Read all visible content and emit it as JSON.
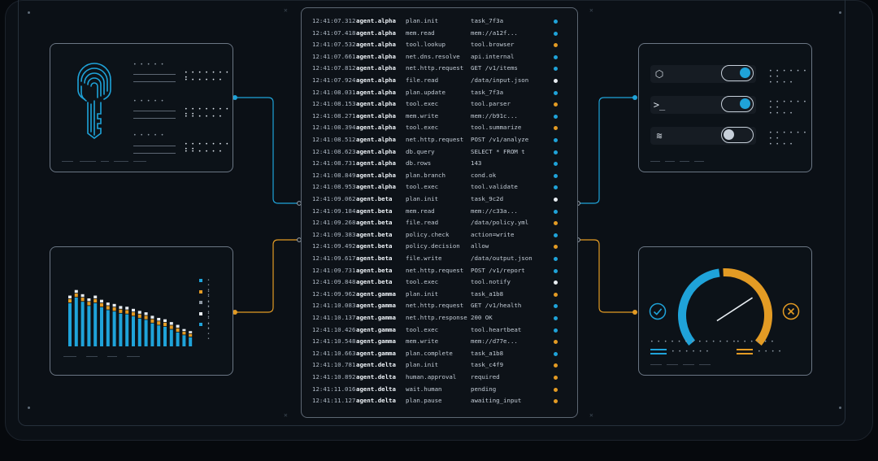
{
  "colors": {
    "blue": "#1fa3d9",
    "orange": "#e39b24",
    "white": "#e8edf2",
    "gray": "#8f99a4"
  },
  "log": [
    {
      "time": "12:41:07.312",
      "agent": "agent.alpha",
      "action": "plan.init",
      "target": "task_7f3a",
      "status": "blue"
    },
    {
      "time": "12:41:07.418",
      "agent": "agent.alpha",
      "action": "mem.read",
      "target": "mem://a12f...",
      "status": "blue"
    },
    {
      "time": "12:41:07.532",
      "agent": "agent.alpha",
      "action": "tool.lookup",
      "target": "tool.browser",
      "status": "orange"
    },
    {
      "time": "12:41:07.661",
      "agent": "agent.alpha",
      "action": "net.dns.resolve",
      "target": "api.internal",
      "status": "blue"
    },
    {
      "time": "12:41:07.812",
      "agent": "agent.alpha",
      "action": "net.http.request",
      "target": "GET /v1/items",
      "status": "blue"
    },
    {
      "time": "12:41:07.924",
      "agent": "agent.alpha",
      "action": "file.read",
      "target": "/data/input.json",
      "status": "white"
    },
    {
      "time": "12:41:08.031",
      "agent": "agent.alpha",
      "action": "plan.update",
      "target": "task_7f3a",
      "status": "blue"
    },
    {
      "time": "12:41:08.153",
      "agent": "agent.alpha",
      "action": "tool.exec",
      "target": "tool.parser",
      "status": "orange"
    },
    {
      "time": "12:41:08.271",
      "agent": "agent.alpha",
      "action": "mem.write",
      "target": "mem://b91c...",
      "status": "blue"
    },
    {
      "time": "12:41:08.394",
      "agent": "agent.alpha",
      "action": "tool.exec",
      "target": "tool.summarize",
      "status": "orange"
    },
    {
      "time": "12:41:08.512",
      "agent": "agent.alpha",
      "action": "net.http.request",
      "target": "POST /v1/analyze",
      "status": "blue"
    },
    {
      "time": "12:41:08.623",
      "agent": "agent.alpha",
      "action": "db.query",
      "target": "SELECT * FROM t",
      "status": "blue"
    },
    {
      "time": "12:41:08.731",
      "agent": "agent.alpha",
      "action": "db.rows",
      "target": "143",
      "status": "blue"
    },
    {
      "time": "12:41:08.849",
      "agent": "agent.alpha",
      "action": "plan.branch",
      "target": "cond.ok",
      "status": "blue"
    },
    {
      "time": "12:41:08.953",
      "agent": "agent.alpha",
      "action": "tool.exec",
      "target": "tool.validate",
      "status": "blue"
    },
    {
      "time": "12:41:09.062",
      "agent": "agent.beta",
      "action": "plan.init",
      "target": "task_9c2d",
      "status": "white"
    },
    {
      "time": "12:41:09.184",
      "agent": "agent.beta",
      "action": "mem.read",
      "target": "mem://c33a...",
      "status": "blue"
    },
    {
      "time": "12:41:09.268",
      "agent": "agent.beta",
      "action": "file.read",
      "target": "/data/policy.yml",
      "status": "orange"
    },
    {
      "time": "12:41:09.383",
      "agent": "agent.beta",
      "action": "policy.check",
      "target": "action=write",
      "status": "blue"
    },
    {
      "time": "12:41:09.492",
      "agent": "agent.beta",
      "action": "policy.decision",
      "target": "allow",
      "status": "orange"
    },
    {
      "time": "12:41:09.617",
      "agent": "agent.beta",
      "action": "file.write",
      "target": "/data/output.json",
      "status": "blue"
    },
    {
      "time": "12:41:09.731",
      "agent": "agent.beta",
      "action": "net.http.request",
      "target": "POST /v1/report",
      "status": "blue"
    },
    {
      "time": "12:41:09.848",
      "agent": "agent.beta",
      "action": "tool.exec",
      "target": "tool.notify",
      "status": "white"
    },
    {
      "time": "12:41:09.962",
      "agent": "agent.gamma",
      "action": "plan.init",
      "target": "task_a1b8",
      "status": "orange"
    },
    {
      "time": "12:41:10.083",
      "agent": "agent.gamma",
      "action": "net.http.request",
      "target": "GET /v1/health",
      "status": "blue"
    },
    {
      "time": "12:41:10.137",
      "agent": "agent.gamma",
      "action": "net.http.response",
      "target": "200 OK",
      "status": "blue"
    },
    {
      "time": "12:41:10.426",
      "agent": "agent.gamma",
      "action": "tool.exec",
      "target": "tool.heartbeat",
      "status": "blue"
    },
    {
      "time": "12:41:10.548",
      "agent": "agent.gamma",
      "action": "mem.write",
      "target": "mem://d77e...",
      "status": "orange"
    },
    {
      "time": "12:41:10.663",
      "agent": "agent.gamma",
      "action": "plan.complete",
      "target": "task_a1b8",
      "status": "blue"
    },
    {
      "time": "12:41:10.781",
      "agent": "agent.delta",
      "action": "plan.init",
      "target": "task_c4f9",
      "status": "orange"
    },
    {
      "time": "12:41:10.892",
      "agent": "agent.delta",
      "action": "human.approval",
      "target": "required",
      "status": "orange"
    },
    {
      "time": "12:41:11.016",
      "agent": "agent.delta",
      "action": "wait.human",
      "target": "pending",
      "status": "orange"
    },
    {
      "time": "12:41:11.127",
      "agent": "agent.delta",
      "action": "plan.pause",
      "target": "awaiting_input",
      "status": "orange"
    }
  ],
  "toggles": [
    {
      "icon": "cube-icon",
      "glyph": "⬡",
      "on": true
    },
    {
      "icon": "terminal-icon",
      "glyph": ">_",
      "on": true
    },
    {
      "icon": "database-icon",
      "glyph": "≋",
      "on": false
    }
  ],
  "bar_chart": {
    "stacks": [
      [
        0.62,
        0.05,
        0.04
      ],
      [
        0.7,
        0.05,
        0.04
      ],
      [
        0.64,
        0.05,
        0.04
      ],
      [
        0.58,
        0.05,
        0.04
      ],
      [
        0.62,
        0.05,
        0.04
      ],
      [
        0.56,
        0.05,
        0.04
      ],
      [
        0.52,
        0.05,
        0.04
      ],
      [
        0.5,
        0.05,
        0.04
      ],
      [
        0.47,
        0.05,
        0.04
      ],
      [
        0.46,
        0.05,
        0.04
      ],
      [
        0.43,
        0.05,
        0.04
      ],
      [
        0.4,
        0.05,
        0.04
      ],
      [
        0.38,
        0.05,
        0.04
      ],
      [
        0.33,
        0.05,
        0.04
      ],
      [
        0.3,
        0.05,
        0.04
      ],
      [
        0.28,
        0.05,
        0.04
      ],
      [
        0.24,
        0.05,
        0.04
      ],
      [
        0.2,
        0.05,
        0.04
      ],
      [
        0.16,
        0.04,
        0.03
      ],
      [
        0.13,
        0.04,
        0.03
      ]
    ],
    "legend_colors": [
      "blue",
      "orange",
      "gray",
      "white",
      "blue"
    ]
  },
  "gauge": {
    "blue_fraction": 0.47,
    "needle_fraction": 0.72
  }
}
